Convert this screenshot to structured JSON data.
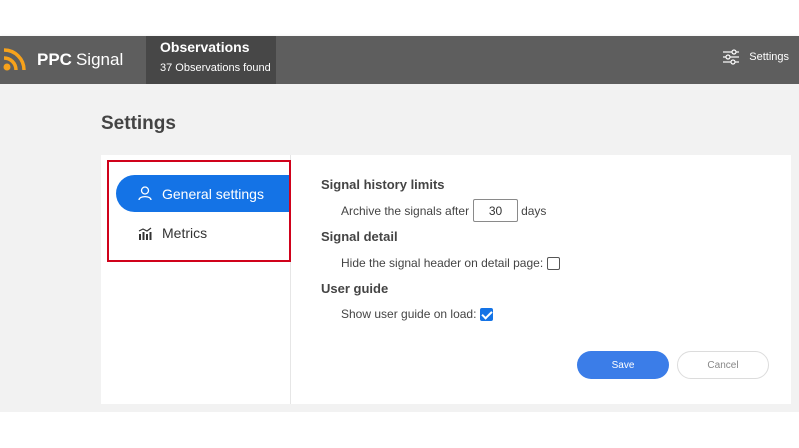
{
  "header": {
    "brand_bold": "PPC",
    "brand_light": "Signal",
    "observations_title": "Observations",
    "observations_count": "37 Observations found",
    "settings_label": "Settings",
    "icons": {
      "logo": "rss-icon",
      "settings": "sliders-icon"
    }
  },
  "page": {
    "title": "Settings"
  },
  "nav": {
    "items": [
      {
        "label": "General settings",
        "icon": "user-icon",
        "active": true
      },
      {
        "label": "Metrics",
        "icon": "bar-chart-icon",
        "active": false
      }
    ]
  },
  "sections": {
    "history": {
      "title": "Signal history limits",
      "archive_prefix": "Archive the signals after",
      "archive_value": "30",
      "archive_suffix": "days"
    },
    "detail": {
      "title": "Signal detail",
      "hide_header_label": "Hide the signal header on detail page:",
      "hide_header_checked": false
    },
    "guide": {
      "title": "User guide",
      "show_guide_label": "Show user guide on load:",
      "show_guide_checked": true
    }
  },
  "actions": {
    "save_label": "Save",
    "cancel_label": "Cancel"
  },
  "colors": {
    "accent": "#1473e6",
    "header_bg": "#5e5e5e",
    "logo": "#f7a21b",
    "highlight": "#d0021b"
  }
}
